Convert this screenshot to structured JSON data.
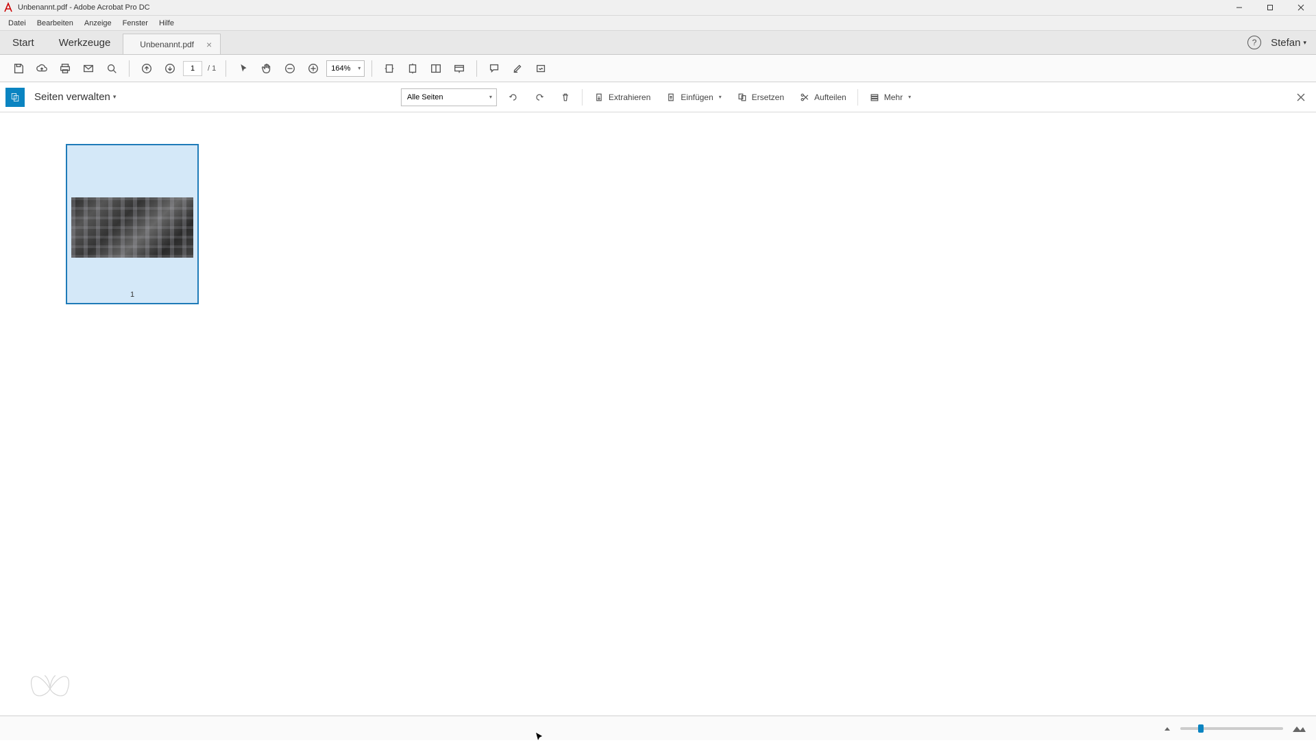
{
  "window": {
    "title": "Unbenannt.pdf - Adobe Acrobat Pro DC"
  },
  "menu": {
    "items": [
      "Datei",
      "Bearbeiten",
      "Anzeige",
      "Fenster",
      "Hilfe"
    ]
  },
  "tabs": {
    "start": "Start",
    "tools": "Werkzeuge",
    "document": "Unbenannt.pdf",
    "user": "Stefan"
  },
  "toolbar": {
    "page_current": "1",
    "page_total": "/ 1",
    "zoom": "164%"
  },
  "organize": {
    "title": "Seiten verwalten",
    "filter": "Alle Seiten",
    "extract": "Extrahieren",
    "insert": "Einfügen",
    "replace": "Ersetzen",
    "split": "Aufteilen",
    "more": "Mehr"
  },
  "thumbnail": {
    "page_number": "1"
  },
  "slider": {
    "position_percent": 17
  }
}
